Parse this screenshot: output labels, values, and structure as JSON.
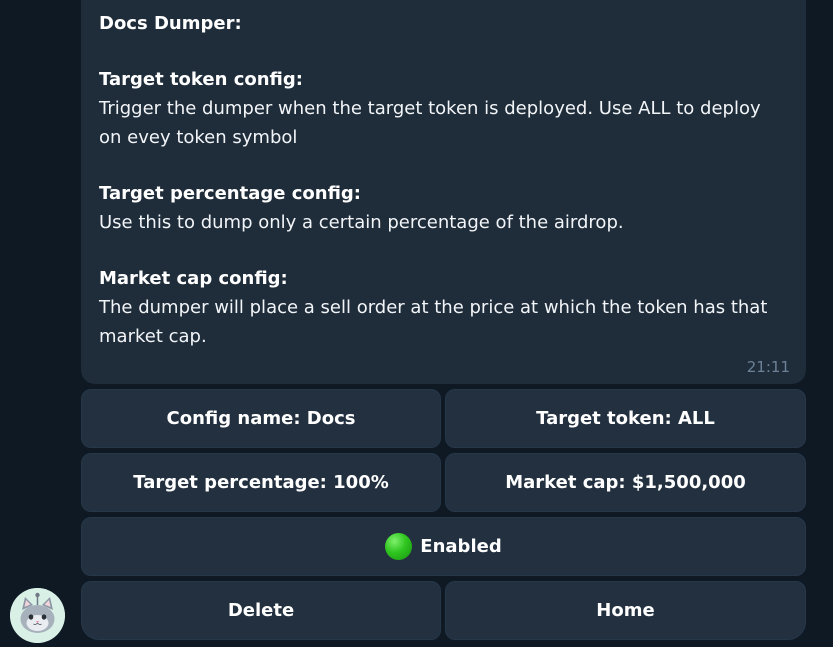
{
  "message": {
    "title": "Docs Dumper:",
    "sections": [
      {
        "heading": "Target token config:",
        "body": "Trigger the dumper when the target token is deployed. Use ALL to deploy on evey token symbol"
      },
      {
        "heading": "Target percentage config:",
        "body": "Use this to dump only a certain percentage of the airdrop."
      },
      {
        "heading": "Market cap config:",
        "body": "The dumper will place a sell order at the price at which the token has that market cap."
      }
    ],
    "time": "21:11"
  },
  "keyboard": {
    "config_name": "Config name: Docs",
    "target_token": "Target token: ALL",
    "target_percentage": "Target percentage: 100%",
    "market_cap": "Market cap: $1,500,000",
    "enabled": "Enabled",
    "delete": "Delete",
    "home": "Home"
  },
  "colors": {
    "background": "#0f1923",
    "bubble": "#1f2c3a",
    "button": "#22303f",
    "status_green": "#2fc51f"
  },
  "icons": {
    "status": "green-circle-icon",
    "avatar": "cat-avatar-icon"
  }
}
